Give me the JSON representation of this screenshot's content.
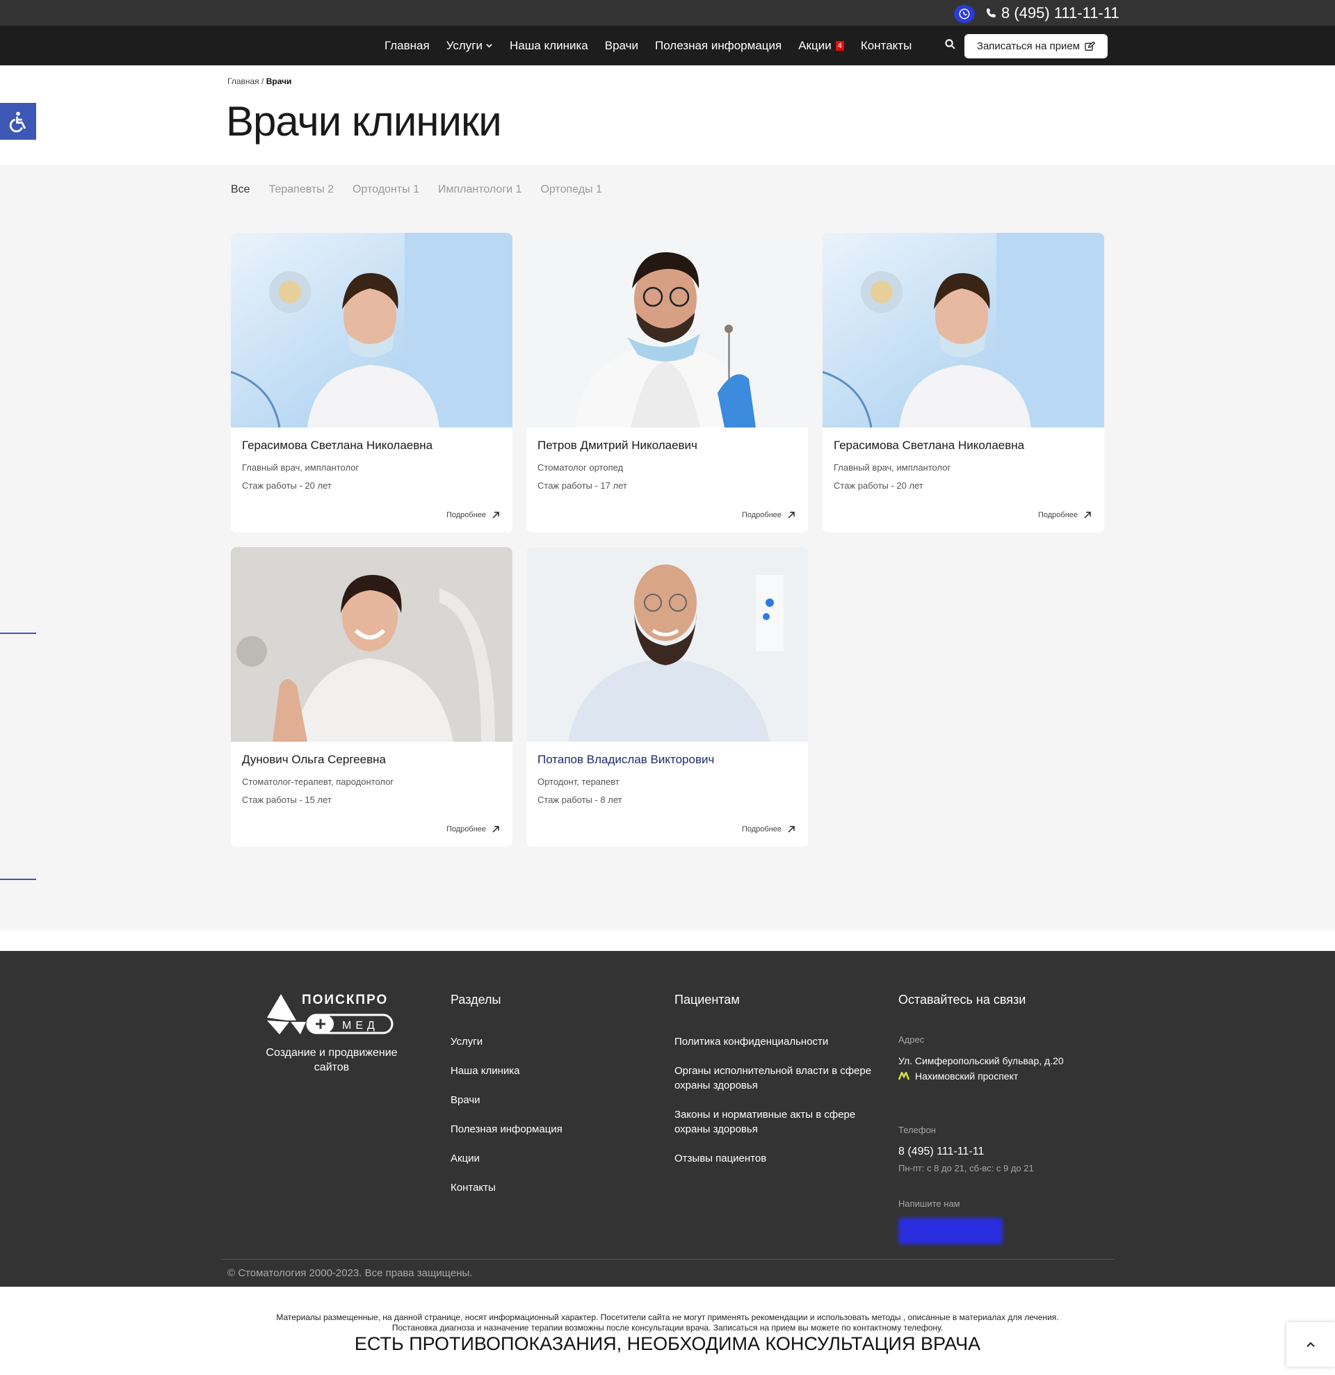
{
  "topbar": {
    "phone": "8 (495) 111-11-11"
  },
  "nav": {
    "items": [
      {
        "label": "Главная"
      },
      {
        "label": "Услуги"
      },
      {
        "label": "Наша клиника"
      },
      {
        "label": "Врачи"
      },
      {
        "label": "Полезная информация"
      },
      {
        "label": "Акции",
        "badge": "4"
      },
      {
        "label": "Контакты"
      }
    ],
    "cta": "Записаться на прием"
  },
  "breadcrumb": {
    "home": "Главная",
    "separator": "/",
    "current": "Врачи"
  },
  "page": {
    "title": "Врачи клиники"
  },
  "filters": [
    "Все",
    "Терапевты 2",
    "Ортодонты 1",
    "Имплантологи 1",
    "Ортопеды 1"
  ],
  "doctors": [
    {
      "name": "Герасимова Светлана Николаевна",
      "role": "Главный врач, имплантолог",
      "experience": "Стаж работы - 20 лет",
      "more": "Подробнее"
    },
    {
      "name": "Петров Дмитрий Николаевич",
      "role": "Стоматолог ортопед",
      "experience": "Стаж работы - 17 лет",
      "more": "Подробнее"
    },
    {
      "name": "Герасимова Светлана Николаевна",
      "role": "Главный врач, имплантолог",
      "experience": "Стаж работы - 20 лет",
      "more": "Подробнее"
    },
    {
      "name": "Дунович Ольга Сергеевна",
      "role": "Стоматолог-терапевт, пародонтолог",
      "experience": "Стаж работы - 15 лет",
      "more": "Подробнее"
    },
    {
      "name": "Потапов Владислав Викторович",
      "role": "Ортодонт, терапевт",
      "experience": "Стаж работы - 8 лет",
      "more": "Подробнее"
    }
  ],
  "footer": {
    "logo": {
      "name": "ПОИСКПРО",
      "sub": "МЕД",
      "tagline": "Создание и продвижение сайтов"
    },
    "sections": {
      "title": "Разделы",
      "links": [
        "Услуги",
        "Наша клиника",
        "Врачи",
        "Полезная информация",
        "Акции",
        "Контакты"
      ]
    },
    "patients": {
      "title": "Пациентам",
      "links": [
        "Политика конфиденциальности",
        "Органы исполнительной власти в сфере охраны здоровья",
        "Законы и нормативные акты в сфере охраны здоровья",
        "Отзывы пациентов"
      ]
    },
    "contact": {
      "title": "Оставайтесь на связи",
      "address_label": "Адрес",
      "address": "Ул. Симферопольский бульвар, д.20",
      "metro": "Нахимовский проспект",
      "phone_label": "Телефон",
      "phone": "8 (495) 111-11-11",
      "hours": "Пн-пт: с 8 до 21, сб-вс: с 9 до 21",
      "write_label": "Напишите нам"
    },
    "copyright": "© Стоматология 2000-2023. Все права защищены."
  },
  "disclaimer": {
    "line1": "Материалы размещенные, на данной странице, носят информационный характер. Посетители сайта не могут применять рекомендации и использовать методы , описанные в материалах для лечения.",
    "line2": "Постановка диагноза и назначение терапии возможны после консультации врача. Записаться на прием вы можете по контактному телефону.",
    "warning": "ЕСТЬ ПРОТИВОПОКАЗАНИЯ, НЕОБХОДИМА КОНСУЛЬТАЦИЯ ВРАЧА"
  },
  "colors": {
    "accent": "#3d57b5",
    "whatsapp": "#2a3bd8",
    "badge": "#e10c0c",
    "footer_bg": "#333333"
  }
}
